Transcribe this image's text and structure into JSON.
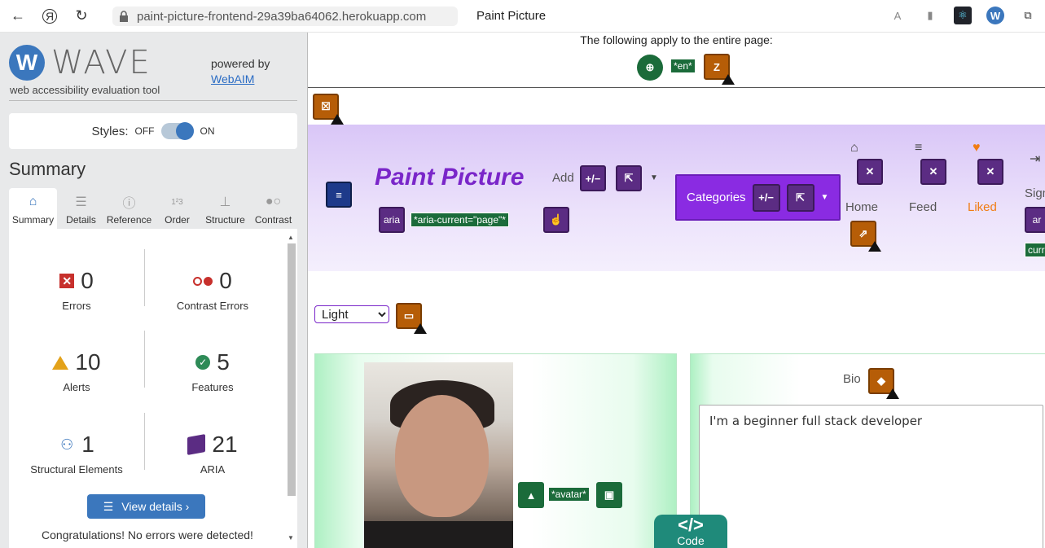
{
  "browser": {
    "url": "paint-picture-frontend-29a39ba64062.herokuapp.com",
    "tab_title": "Paint Picture"
  },
  "wave": {
    "logo_word": "WAVE",
    "subtitle": "web accessibility evaluation tool",
    "powered_by": "powered by",
    "webaim": "WebAIM",
    "styles_label": "Styles:",
    "off": "OFF",
    "on": "ON",
    "summary_heading": "Summary",
    "tabs": [
      {
        "label": "Summary"
      },
      {
        "label": "Details"
      },
      {
        "label": "Reference"
      },
      {
        "label": "Order"
      },
      {
        "label": "Structure"
      },
      {
        "label": "Contrast"
      }
    ],
    "stats": {
      "errors": {
        "count": "0",
        "label": "Errors"
      },
      "contrast": {
        "count": "0",
        "label": "Contrast Errors"
      },
      "alerts": {
        "count": "10",
        "label": "Alerts"
      },
      "features": {
        "count": "5",
        "label": "Features"
      },
      "structural": {
        "count": "1",
        "label": "Structural Elements"
      },
      "aria": {
        "count": "21",
        "label": "ARIA"
      }
    },
    "view_details": "View details ›",
    "congrats": "Congratulations! No errors were detected!"
  },
  "page": {
    "applies_text": "The following apply to the entire page:",
    "lang_tag": "*en*",
    "brand": "Paint Picture",
    "add_label": "Add",
    "aria_label_tag": "aria",
    "aria_current_tag": "*aria-current=\"page\"*",
    "categories_label": "Categories",
    "nav": {
      "home": "Home",
      "feed": "Feed",
      "liked": "Liked",
      "sign_partial": "Sign",
      "aria_partial": "ar",
      "curr_partial": "curr"
    },
    "theme_select": {
      "selected": "Light"
    },
    "avatar_tag": "*avatar*",
    "bio_label": "Bio",
    "bio_text": "I'm a beginner full stack developer",
    "code_label": "Code",
    "code_symbol": "</>"
  },
  "colors": {
    "wave_blue": "#3b77bd",
    "brand_purple": "#7a26c9",
    "categories_bg": "#8a2be2",
    "liked_orange": "#f07c12",
    "code_teal": "#1f8a7a"
  }
}
